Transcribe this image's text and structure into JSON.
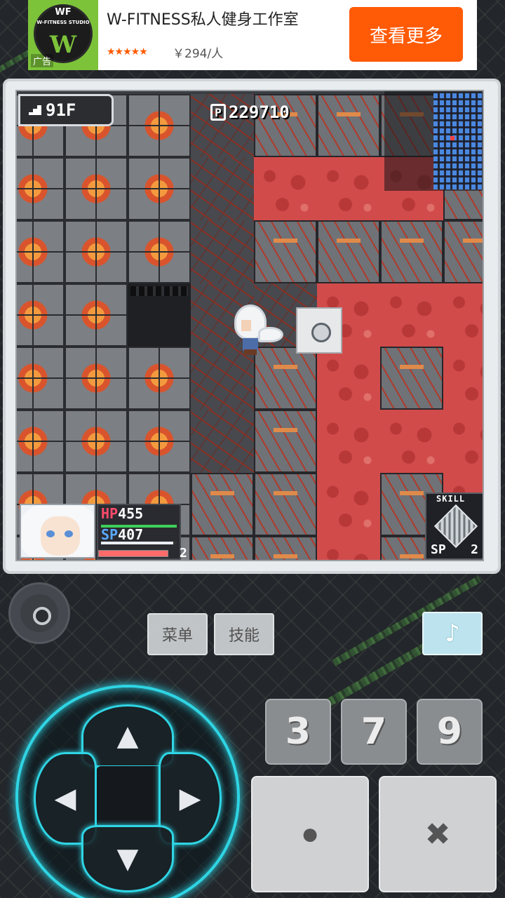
{
  "ad": {
    "logo_text": "W-FITNESS STUDIO",
    "logo_wf": "WF",
    "logo_big": "W",
    "tag": "广告",
    "title": "W-FITNESS私人健身工作室",
    "stars": "★★★★★",
    "rating": 5,
    "price": "￥294/人",
    "cta": "查看更多"
  },
  "hud": {
    "floor": "91F",
    "gold": "229710",
    "gold_icon": "P",
    "hp_label": "HP",
    "hp": "455",
    "sp_label": "SP",
    "sp": "407",
    "level": "2",
    "skill_label": "SKILL",
    "skill_sp_label": "SP",
    "skill_sp": "2"
  },
  "controls": {
    "menu": "菜单",
    "skill": "技能",
    "music": "♪",
    "dpad_up": "▲",
    "dpad_down": "▼",
    "dpad_left": "◀",
    "dpad_right": "▶",
    "num3": "3",
    "num7": "7",
    "num9": "9",
    "action_o": "●",
    "action_x": "✖"
  },
  "colors": {
    "ad_cta": "#ff5a06",
    "hp": "#ff4a6a",
    "sp": "#5aa8ff",
    "dpad_glow": "#2fd5e4",
    "lava": "#d24b4b"
  },
  "map": {
    "rows": [
      [
        "rock",
        "rock",
        "rock",
        "floor",
        "slab",
        "slab",
        "slab",
        "slab"
      ],
      [
        "rock",
        "rock",
        "rock",
        "floor",
        "lava",
        "lava",
        "lava",
        "slab"
      ],
      [
        "rock",
        "rock",
        "rock",
        "floor",
        "slab",
        "slab",
        "slab",
        "slab"
      ],
      [
        "rock",
        "rock",
        "pit",
        "floor",
        "floor",
        "lava",
        "lava",
        "lava"
      ],
      [
        "rock",
        "rock",
        "rock",
        "floor",
        "slab",
        "lava",
        "slab",
        "lava"
      ],
      [
        "rock",
        "rock",
        "rock",
        "floor",
        "slab",
        "lava",
        "lava",
        "lava"
      ],
      [
        "rock",
        "rock",
        "rock",
        "slab",
        "slab",
        "lava",
        "slab",
        "lava"
      ],
      [
        "rock",
        "rock",
        "rock",
        "slab",
        "slab",
        "lava",
        "slab",
        "lava"
      ]
    ]
  }
}
